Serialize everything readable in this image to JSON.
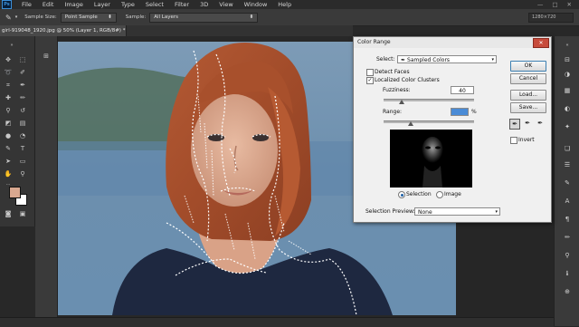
{
  "menubar": {
    "items": [
      "File",
      "Edit",
      "Image",
      "Layer",
      "Type",
      "Select",
      "Filter",
      "3D",
      "View",
      "Window",
      "Help"
    ],
    "controls": [
      "—",
      "□",
      "✕"
    ]
  },
  "options": {
    "sample_size_label": "Sample Size:",
    "sample_size_value": "Point Sample",
    "sample_label": "Sample:",
    "sample_value": "All Layers",
    "search_placeholder": "1280×720"
  },
  "document": {
    "tab_title": "girl-919048_1920.jpg @ 50% (Layer 1, RGB/8#) *",
    "close": "×"
  },
  "dialog": {
    "title": "Color Range",
    "close": "✕",
    "select_label": "Select:",
    "select_value": "Sampled Colors",
    "detect_faces_label": "Detect Faces",
    "detect_faces_checked": false,
    "localized_label": "Localized Color Clusters",
    "localized_checked": true,
    "fuzziness_label": "Fuzziness:",
    "fuzziness_value": "40",
    "range_label": "Range:",
    "range_value": "",
    "range_unit": "%",
    "selection_label": "Selection",
    "image_label": "Image",
    "preview_label": "Selection Preview:",
    "preview_value": "None",
    "buttons": {
      "ok": "OK",
      "cancel": "Cancel",
      "load": "Load...",
      "save": "Save..."
    },
    "invert_label": "Invert",
    "invert_checked": false,
    "fuzziness_slider": 0.2,
    "range_slider": 0.3
  },
  "colors": {
    "foreground": "#d8a890",
    "background": "#ffffff",
    "selection_ants": "#ffffff"
  }
}
